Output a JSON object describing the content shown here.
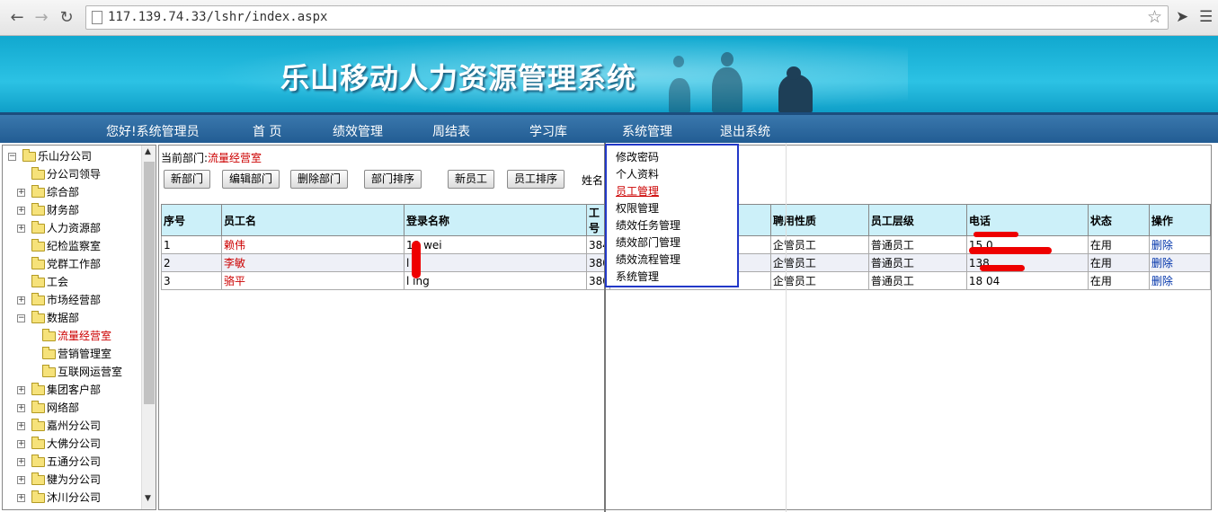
{
  "browser": {
    "url": "117.139.74.33/lshr/index.aspx"
  },
  "banner": {
    "title": "乐山移动人力资源管理系统"
  },
  "nav": {
    "greeting": "您好!系统管理员",
    "items": [
      "首 页",
      "绩效管理",
      "周结表",
      "学习库",
      "系统管理",
      "退出系统"
    ]
  },
  "tree": {
    "items": [
      {
        "label": "乐山分公司",
        "expander": "−"
      },
      {
        "label": "分公司领导",
        "expander": ""
      },
      {
        "label": "综合部",
        "expander": "+"
      },
      {
        "label": "财务部",
        "expander": "+"
      },
      {
        "label": "人力资源部",
        "expander": "+"
      },
      {
        "label": "纪检监察室",
        "expander": ""
      },
      {
        "label": "党群工作部",
        "expander": ""
      },
      {
        "label": "工会",
        "expander": ""
      },
      {
        "label": "市场经营部",
        "expander": "+"
      },
      {
        "label": "数据部",
        "expander": "−"
      },
      {
        "label": "流量经营室",
        "expander": "",
        "active": true
      },
      {
        "label": "营销管理室",
        "expander": ""
      },
      {
        "label": "互联网运营室",
        "expander": ""
      },
      {
        "label": "集团客户部",
        "expander": "+"
      },
      {
        "label": "网络部",
        "expander": "+"
      },
      {
        "label": "嘉州分公司",
        "expander": "+"
      },
      {
        "label": "大佛分公司",
        "expander": "+"
      },
      {
        "label": "五通分公司",
        "expander": "+"
      },
      {
        "label": "犍为分公司",
        "expander": "+"
      },
      {
        "label": "沐川分公司",
        "expander": "+"
      }
    ]
  },
  "main": {
    "dept_prefix": "当前部门:",
    "dept_name": "流量经营室",
    "buttons": [
      "新部门",
      "编辑部门",
      "删除部门",
      "部门排序",
      "新员工",
      "员工排序"
    ],
    "name_label": "姓名"
  },
  "table": {
    "headers": [
      "序号",
      "员工名",
      "登录名称",
      "工号",
      "",
      "聘用性质",
      "员工层级",
      "电话",
      "状态",
      "操作"
    ],
    "rows": [
      [
        "1",
        "赖伟",
        "19 wei",
        "384",
        "",
        "企管员工",
        "普通员工",
        "15            0",
        "在用",
        "删除"
      ],
      [
        "2",
        "李敏",
        "l    n",
        "380",
        "",
        "企管员工",
        "普通员工",
        "138",
        "在用",
        "删除"
      ],
      [
        "3",
        "骆平",
        "l    ing",
        "380",
        "",
        "企管员工",
        "普通员工",
        "18          04",
        "在用",
        "删除"
      ]
    ]
  },
  "dropdown": {
    "items": [
      "修改密码",
      "个人资料",
      "员工管理",
      "权限管理",
      "绩效任务管理",
      "绩效部门管理",
      "绩效流程管理",
      "系统管理"
    ],
    "active_index": 2
  }
}
